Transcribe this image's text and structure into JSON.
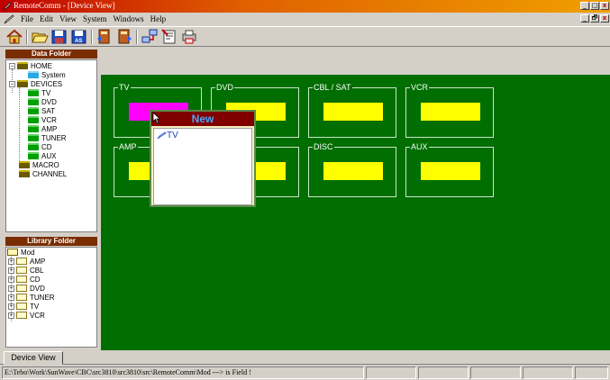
{
  "window": {
    "title": "RemoteComm - [Device View]",
    "minimize": "_",
    "maximize": "□",
    "restore": "🗗",
    "close": "x"
  },
  "menu": {
    "items": [
      "File",
      "Edit",
      "View",
      "System",
      "Windows",
      "Help"
    ]
  },
  "toolbar": {
    "buttons": [
      "home-icon",
      "open-folder-icon",
      "save-icon",
      "save-as-icon",
      "book-open-icon",
      "book-close-icon",
      "network-icon",
      "export-icon",
      "print-icon"
    ]
  },
  "data_folder": {
    "header": "Data Folder",
    "items": [
      {
        "label": "HOME",
        "icon": "folder-icon",
        "expander": "−"
      },
      {
        "label": "System",
        "icon": "folder-cyan-icon"
      },
      {
        "label": "DEVICES",
        "icon": "folder-icon",
        "expander": "−"
      },
      {
        "label": "TV",
        "icon": "folder-green-icon"
      },
      {
        "label": "DVD",
        "icon": "folder-green-icon"
      },
      {
        "label": "SAT",
        "icon": "folder-green-icon"
      },
      {
        "label": "VCR",
        "icon": "folder-green-icon"
      },
      {
        "label": "AMP",
        "icon": "folder-green-icon"
      },
      {
        "label": "TUNER",
        "icon": "folder-green-icon"
      },
      {
        "label": "CD",
        "icon": "folder-green-icon"
      },
      {
        "label": "AUX",
        "icon": "folder-green-icon"
      },
      {
        "label": "MACRO",
        "icon": "folder-icon"
      },
      {
        "label": "CHANNEL",
        "icon": "folder-icon"
      }
    ]
  },
  "library_folder": {
    "header": "Library Folder",
    "items": [
      {
        "label": "Mod",
        "icon": "open-folder-icon"
      },
      {
        "label": "AMP",
        "icon": "folder-icon",
        "expander": "+"
      },
      {
        "label": "CBL",
        "icon": "folder-icon",
        "expander": "+"
      },
      {
        "label": "CD",
        "icon": "folder-icon",
        "expander": "+"
      },
      {
        "label": "DVD",
        "icon": "folder-icon",
        "expander": "+"
      },
      {
        "label": "TUNER",
        "icon": "folder-icon",
        "expander": "+"
      },
      {
        "label": "TV",
        "icon": "folder-icon",
        "expander": "+"
      },
      {
        "label": "VCR",
        "icon": "folder-icon",
        "expander": "+"
      }
    ]
  },
  "device_view": {
    "groups": [
      {
        "label": "TV",
        "active": true
      },
      {
        "label": "DVD",
        "active": false
      },
      {
        "label": "CBL / SAT",
        "active": false
      },
      {
        "label": "VCR",
        "active": false
      },
      {
        "label": "AMP",
        "active": false
      },
      {
        "label": "",
        "active": false
      },
      {
        "label": "DISC",
        "active": false
      },
      {
        "label": "AUX",
        "active": false
      }
    ]
  },
  "popup": {
    "title": "New",
    "item": "TV"
  },
  "tabs": {
    "device_view": "Device View"
  },
  "status": {
    "message": "E:\\Tebo\\Work\\SunWave\\CBC\\src3810\\src3810\\src\\RemoteComm\\Mod ---> is Field !"
  },
  "colors": {
    "green_bg": "#006e00",
    "slot_yellow": "#ffff00",
    "slot_active": "#ff00ff",
    "panel_header": "#7a2d00",
    "popup_header": "#800000"
  }
}
